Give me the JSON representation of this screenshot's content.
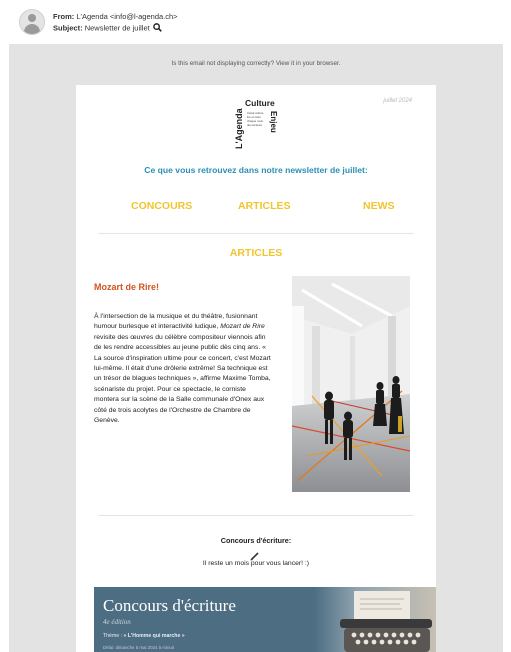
{
  "email": {
    "from_label": "From:",
    "from_value": "L'Agenda <info@l-agenda.ch>",
    "subject_label": "Subject:",
    "subject_value": "Newsletter de juillet"
  },
  "icons": {
    "avatar": "user-avatar-icon",
    "search": "magnifier-icon",
    "pencil": "pencil-icon",
    "typewriter": "typewriter-image"
  },
  "view_in_browser": "Is this email not displaying correctly? View it in your browser.",
  "newsletter": {
    "date": "juillet 2024",
    "logo": {
      "vertical_left": "L'Agenda",
      "culture": "Culture",
      "vertical_right": "Enjeu",
      "small_lines": [
        "Canal culture",
        "lire et relire",
        "chaque mois",
        "des lectures"
      ]
    },
    "intro": "Ce que vous retrouvez dans notre newsletter de juillet:",
    "nav": [
      "CONCOURS",
      "ARTICLES",
      "NEWS"
    ],
    "section_heading": "ARTICLES",
    "article": {
      "title": "Mozart de Rire!",
      "body_before": "À l'intersection de la musique et du théâtre, fusionnant humour burlesque et interactivité ludique, ",
      "body_italic": "Mozart de Rire",
      "body_after": " revisite des œuvres du célèbre compositeur viennois afin de les rendre accessibles au jeune public dès cinq ans. « La source d'inspiration ultime pour ce concert, c'est Mozart lui-même. Il était d'une drôlerie extrême! Sa technique est un trésor de blagues techniques », affirme Maxime Tomba, scénariste du projet. Pour ce spectacle, le corniste montera sur la scène de la Salle communale d'Onex aux côté de trois acolytes de l'Orchestre de Chambre de Genève."
    },
    "concours": {
      "heading": "Concours d'écriture:",
      "text": "Il reste un mois pour vous lancer! :)",
      "banner": {
        "title": "Concours d'écriture",
        "edition": "4e édition",
        "theme_prefix": "Thème : ",
        "theme": "« L'Homme qui marche »",
        "deadline": "Délai: dimanche 5 mai 2024 à minuit"
      }
    }
  },
  "colors": {
    "intro": "#2a8fb5",
    "nav": "#f1c52e",
    "article_title": "#d2541d",
    "banner": "#4d6d83",
    "background": "#e3e3e3"
  }
}
